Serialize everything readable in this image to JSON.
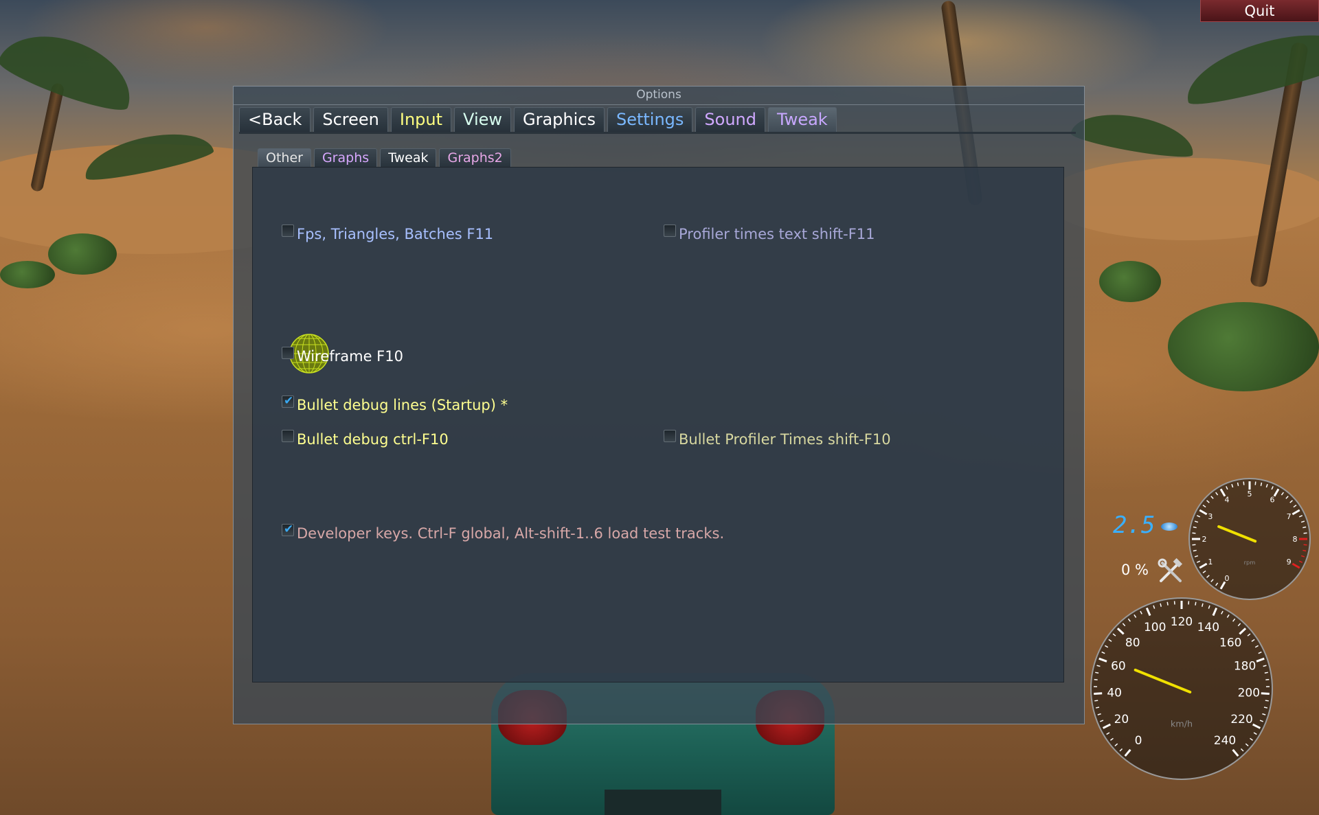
{
  "window": {
    "title": "Options"
  },
  "quit": {
    "label": "Quit"
  },
  "main_tabs": [
    {
      "label": "<Back",
      "color": "#ffffff"
    },
    {
      "label": "Screen",
      "color": "#ffffff"
    },
    {
      "label": "Input",
      "color": "#ffff80"
    },
    {
      "label": "View",
      "color": "#d8fff0"
    },
    {
      "label": "Graphics",
      "color": "#ffffff"
    },
    {
      "label": "Settings",
      "color": "#7ab8ff"
    },
    {
      "label": "Sound",
      "color": "#d0a8ff"
    },
    {
      "label": "Tweak",
      "color": "#c8a8ff"
    }
  ],
  "active_main_tab": "Tweak",
  "sub_tabs": [
    {
      "label": "Other",
      "color": "#e6e6e6"
    },
    {
      "label": "Graphs",
      "color": "#d8a8ff"
    },
    {
      "label": "Tweak",
      "color": "#ffffff"
    },
    {
      "label": "Graphs2",
      "color": "#e8a8e8"
    }
  ],
  "active_sub_tab": "Other",
  "options": {
    "fps": {
      "label": "Fps, Triangles, Batches  F11",
      "checked": false,
      "color": "#a8c0ff"
    },
    "profiler_text": {
      "label": "Profiler times text   shift-F11",
      "checked": false,
      "color": "#a8a8d8"
    },
    "wireframe": {
      "label": "Wireframe  F10",
      "checked": false,
      "color": "#ffffff"
    },
    "bullet_lines": {
      "label": "Bullet debug lines (Startup) *",
      "checked": true,
      "color": "#ffff90"
    },
    "bullet_debug": {
      "label": "Bullet debug  ctrl-F10",
      "checked": false,
      "color": "#ffff90"
    },
    "bullet_profiler": {
      "label": "Bullet Profiler Times  shift-F10",
      "checked": false,
      "color": "#d8d8a0"
    },
    "developer_keys": {
      "label": "Developer keys. Ctrl-F global, Alt-shift-1..6 load test tracks.",
      "checked": true,
      "color": "#d8a8a8"
    }
  },
  "icons": {
    "wireframe": "wireframe-globe-icon",
    "damage": "wrench-hammer-icon",
    "boost": "boost-flame-icon"
  },
  "hud": {
    "gear": "2.5",
    "damage": "0 %",
    "rpm_ticks": [
      "0",
      "1",
      "2",
      "3",
      "4",
      "5",
      "6",
      "7",
      "8",
      "9"
    ],
    "speed_ticks": [
      "0",
      "20",
      "40",
      "60",
      "80",
      "100",
      "120",
      "140",
      "160",
      "180",
      "200",
      "220",
      "240"
    ],
    "speed_unit": "km/h",
    "rpm_unit": "rpm"
  }
}
